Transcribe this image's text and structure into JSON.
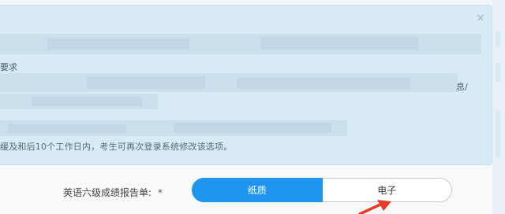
{
  "notice": {
    "close_icon": "×",
    "fragment_line3": "要求",
    "fragment_right": "息/",
    "last_line": "缓及和后10个工作日内，考生可再次登录系统修改该选项。"
  },
  "form": {
    "label": "英语六级成绩报告单:",
    "required_mark": "*",
    "options": [
      {
        "label": "纸质",
        "selected": true
      },
      {
        "label": "电子",
        "selected": false
      }
    ]
  },
  "colors": {
    "accent": "#1e96f0",
    "notice_bg": "#d8eaf5",
    "annotation_arrow": "#e83a26"
  }
}
